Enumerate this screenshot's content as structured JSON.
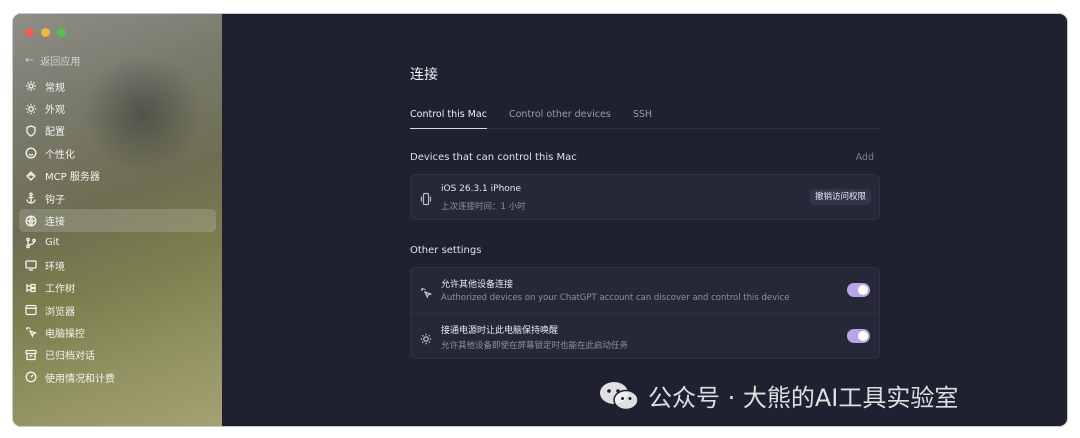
{
  "sidebar": {
    "back_label": "返回应用",
    "items": [
      {
        "label": "常规",
        "icon": "gear-icon"
      },
      {
        "label": "外观",
        "icon": "sun-icon"
      },
      {
        "label": "配置",
        "icon": "shield-icon"
      },
      {
        "label": "个性化",
        "icon": "smile-icon"
      },
      {
        "label": "MCP 服务器",
        "icon": "mcp-icon"
      },
      {
        "label": "钩子",
        "icon": "anchor-icon"
      },
      {
        "label": "连接",
        "icon": "globe-icon"
      },
      {
        "label": "Git",
        "icon": "git-branch-icon"
      },
      {
        "label": "环境",
        "icon": "monitor-icon"
      },
      {
        "label": "工作树",
        "icon": "worktree-icon"
      },
      {
        "label": "浏览器",
        "icon": "browser-icon"
      },
      {
        "label": "电脑操控",
        "icon": "cursor-click-icon"
      },
      {
        "label": "已归档对话",
        "icon": "archive-icon"
      },
      {
        "label": "使用情况和计费",
        "icon": "gauge-icon"
      }
    ],
    "active_index": 6
  },
  "main": {
    "title": "连接",
    "tabs": [
      {
        "label": "Control this Mac",
        "active": true
      },
      {
        "label": "Control other devices",
        "active": false
      },
      {
        "label": "SSH",
        "active": false
      }
    ],
    "devices_section": {
      "title": "Devices that can control this Mac",
      "add_label": "Add",
      "device": {
        "name": "iOS 26.3.1 iPhone",
        "last_connected": "上次连接时间：1 小时",
        "revoke_label": "撤销访问权限"
      }
    },
    "other_settings": {
      "title": "Other settings",
      "items": [
        {
          "title": "允许其他设备连接",
          "description": "Authorized devices on your ChatGPT account can discover and control this device",
          "enabled": true
        },
        {
          "title": "接通电源时让此电脑保持唤醒",
          "description": "允许其他设备即使在屏幕锁定时也能在此启动任务",
          "enabled": true
        }
      ]
    }
  },
  "watermark": {
    "text": "公众号 · 大熊的AI工具实验室"
  },
  "colors": {
    "toggle_on": "#b9a4e6",
    "main_bg": "#1f2130",
    "card_bg": "#262838"
  }
}
